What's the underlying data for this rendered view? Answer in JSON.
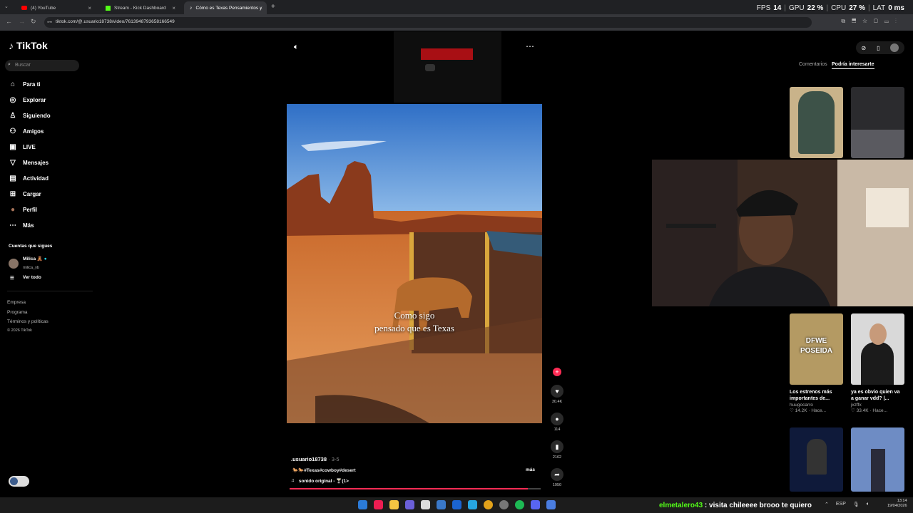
{
  "browser": {
    "tabs": [
      "(4) YouTube",
      "Stream - Kick Dashboard",
      "Cómo es Texas Pensamientos y"
    ],
    "url": "tiktok.com/@.usuario18738/video/7613948793658166549"
  },
  "overlay": {
    "fps_label": "FPS",
    "fps": "14",
    "gpu_label": "GPU",
    "gpu": "22 %",
    "cpu_label": "CPU",
    "cpu": "27 %",
    "lat_label": "LAT",
    "lat": "0 ms"
  },
  "sidebar": {
    "logo": "TikTok",
    "search_placeholder": "Buscar",
    "items": [
      {
        "label": "Para ti",
        "icon": "home-icon"
      },
      {
        "label": "Explorar",
        "icon": "compass-icon"
      },
      {
        "label": "Siguiendo",
        "icon": "following-icon"
      },
      {
        "label": "Amigos",
        "icon": "friends-icon"
      },
      {
        "label": "LIVE",
        "icon": "live-icon"
      },
      {
        "label": "Mensajes",
        "icon": "messages-icon"
      },
      {
        "label": "Actividad",
        "icon": "activity-icon"
      },
      {
        "label": "Cargar",
        "icon": "upload-icon"
      },
      {
        "label": "Perfil",
        "icon": "profile-icon"
      },
      {
        "label": "Más",
        "icon": "more-icon"
      }
    ],
    "following_header": "Cuentas que sigues",
    "following": {
      "name": "Milica 🧸",
      "handle": "milica_yb"
    },
    "see_all": "Ver todo",
    "footer": [
      "Empresa",
      "Programa",
      "Términos y políticas",
      "© 2026 TikTok"
    ]
  },
  "video": {
    "caption_line1": "Como sigo",
    "caption_line2": "pensado que es Texas",
    "author": ".usuario18738",
    "date": "· 3-5",
    "hashtags": "🐎🐎#Texas#cowboy#desert",
    "sound": "sonido original - 🍸(1>",
    "more": "más",
    "likes": "30.4K",
    "comments": "114",
    "saves": "2162",
    "shares": "1950",
    "progress": 0.95
  },
  "right": {
    "tabs": [
      "Comentarios",
      "Podría interesarte"
    ],
    "cards": [
      {
        "title": "Los estrenos más importantes de...",
        "author": "huugocarro",
        "likes": "♡ 14.2K",
        "time": "· Hace..."
      },
      {
        "title": "ya es obvio quien va a ganar vdd? |...",
        "author": "jxzffx",
        "likes": "♡ 33.4K",
        "time": "· Hace..."
      }
    ],
    "thumb_text": {
      "t3_line1": "DFWE",
      "t3_line2": "POSEIDA"
    }
  },
  "chat": "elmetalero43 : visita chileeee brooo te quiero",
  "taskbar": {
    "lang": "ESP",
    "time": "13:14",
    "date": "19/04/2026"
  },
  "colors": {
    "accent": "#fe2c55",
    "chat": "#53fc18"
  }
}
